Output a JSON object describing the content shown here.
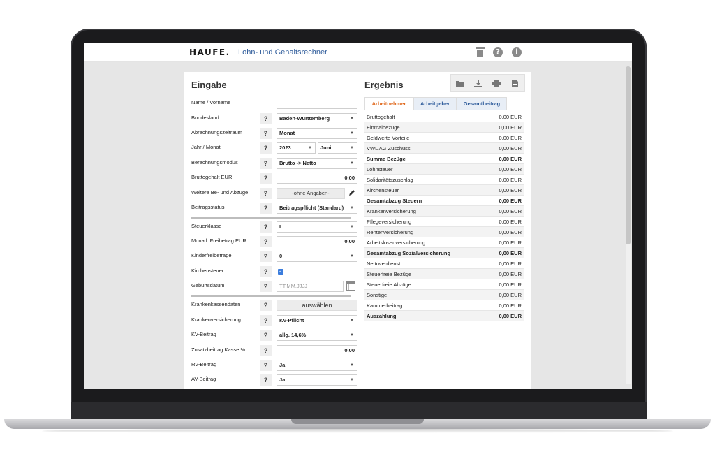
{
  "header": {
    "logo": "HAUFE.",
    "title": "Lohn- und Gehaltsrechner",
    "help_icon_glyph": "?",
    "info_icon_glyph": "i"
  },
  "input": {
    "title": "Eingabe",
    "help_glyph": "?",
    "name": {
      "label": "Name / Vorname",
      "value": ""
    },
    "bundesland": {
      "label": "Bundesland",
      "value": "Baden-Württemberg"
    },
    "abrechnungszeitraum": {
      "label": "Abrechnungszeitraum",
      "value": "Monat"
    },
    "jahr_monat": {
      "label": "Jahr / Monat",
      "year": "2023",
      "month": "Juni"
    },
    "berechnungsmodus": {
      "label": "Berechnungsmodus",
      "value": "Brutto -> Netto"
    },
    "bruttogehalt": {
      "label": "Bruttogehalt EUR",
      "value": "0,00"
    },
    "weitere": {
      "label": "Weitere Be- und Abzüge",
      "value": "-ohne Angaben-"
    },
    "beitragsstatus": {
      "label": "Beitragsstatus",
      "value": "Beitragspflicht (Standard)"
    },
    "steuerklasse": {
      "label": "Steuerklasse",
      "value": "I"
    },
    "freibetrag": {
      "label": "Monatl. Freibetrag EUR",
      "value": "0,00"
    },
    "kinderfreibetraege": {
      "label": "Kinderfreibeträge",
      "value": "0"
    },
    "kirchensteuer": {
      "label": "Kirchensteuer",
      "checked": true
    },
    "geburtsdatum": {
      "label": "Geburtsdatum",
      "placeholder": "TT.MM.JJJJ"
    },
    "krankenkassendaten": {
      "label": "Krankenkassendaten",
      "button": "auswählen"
    },
    "krankenversicherung": {
      "label": "Krankenversicherung",
      "value": "KV-Pflicht"
    },
    "kv_beitrag": {
      "label": "KV-Beitrag",
      "value": "allg. 14,6%"
    },
    "zusatzbeitrag": {
      "label": "Zusatzbeitrag Kasse %",
      "value": "0,00"
    },
    "rv_beitrag": {
      "label": "RV-Beitrag",
      "value": "Ja"
    },
    "av_beitrag": {
      "label": "AV-Beitrag",
      "value": "Ja"
    }
  },
  "result": {
    "title": "Ergebnis",
    "tabs": [
      "Arbeitnehmer",
      "Arbeitgeber",
      "Gesamtbeitrag"
    ],
    "rows": [
      {
        "label": "Bruttogehalt",
        "value": "0,00 EUR",
        "bold": false
      },
      {
        "label": "Einmalbezüge",
        "value": "0,00 EUR",
        "bold": false
      },
      {
        "label": "Geldwerte Vorteile",
        "value": "0,00 EUR",
        "bold": false
      },
      {
        "label": "VWL AG Zuschuss",
        "value": "0,00 EUR",
        "bold": false
      },
      {
        "label": "Summe Bezüge",
        "value": "0,00 EUR",
        "bold": true
      },
      {
        "label": "Lohnsteuer",
        "value": "0,00 EUR",
        "bold": false
      },
      {
        "label": "Solidaritätszuschlag",
        "value": "0,00 EUR",
        "bold": false
      },
      {
        "label": "Kirchensteuer",
        "value": "0,00 EUR",
        "bold": false
      },
      {
        "label": "Gesamtabzug Steuern",
        "value": "0,00 EUR",
        "bold": true
      },
      {
        "label": "Krankenversicherung",
        "value": "0,00 EUR",
        "bold": false
      },
      {
        "label": "Pflegeversicherung",
        "value": "0,00 EUR",
        "bold": false
      },
      {
        "label": "Rentenversicherung",
        "value": "0,00 EUR",
        "bold": false
      },
      {
        "label": "Arbeitslosenversicherung",
        "value": "0,00 EUR",
        "bold": false
      },
      {
        "label": "Gesamtabzug Sozialversicherung",
        "value": "0,00 EUR",
        "bold": true
      },
      {
        "label": "Nettoverdienst",
        "value": "0,00 EUR",
        "bold": false
      },
      {
        "label": "Steuerfreie Bezüge",
        "value": "0,00 EUR",
        "bold": false
      },
      {
        "label": "Steuerfreie Abzüge",
        "value": "0,00 EUR",
        "bold": false
      },
      {
        "label": "Sonstige",
        "value": "0,00 EUR",
        "bold": false
      },
      {
        "label": "Kammerbeitrag",
        "value": "0,00 EUR",
        "bold": false
      },
      {
        "label": "Auszahlung",
        "value": "0,00 EUR",
        "bold": true
      }
    ]
  },
  "colors": {
    "brand_blue": "#2f5c9b",
    "active_tab": "#e06a1f",
    "checkbox": "#3b7ddd"
  }
}
